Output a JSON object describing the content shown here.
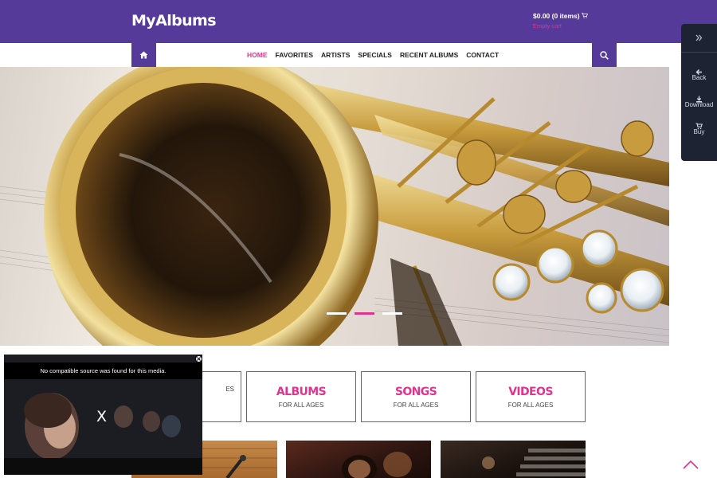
{
  "header": {
    "logo": "MyAlbums",
    "cart_total": "$0.00 (0 items)",
    "cart_status": "Empty cart"
  },
  "nav": {
    "items": [
      {
        "label": "HOME",
        "active": true
      },
      {
        "label": "FAVORITES"
      },
      {
        "label": "ARTISTS"
      },
      {
        "label": "SPECIALS"
      },
      {
        "label": "RECENT ALBUMS"
      },
      {
        "label": "CONTACT"
      }
    ]
  },
  "hero": {
    "slides": 3,
    "active_slide": 2
  },
  "side_panel": {
    "items": [
      {
        "label": "Back",
        "icon": "arrow-left-icon"
      },
      {
        "label": "Download",
        "icon": "download-icon"
      },
      {
        "label": "Buy",
        "icon": "cart-icon"
      }
    ]
  },
  "categories": [
    {
      "title": "",
      "subtitle": "ES"
    },
    {
      "title": "ALBUMS",
      "subtitle": "FOR ALL AGES"
    },
    {
      "title": "SONGS",
      "subtitle": "FOR ALL AGES"
    },
    {
      "title": "VIDEOS",
      "subtitle": "FOR ALL AGES"
    }
  ],
  "video": {
    "message": "No compatible source was found for this media.",
    "close_glyph": "X"
  },
  "colors": {
    "brand": "#553a99",
    "accent": "#e0338f",
    "panel": "#1d2333"
  }
}
